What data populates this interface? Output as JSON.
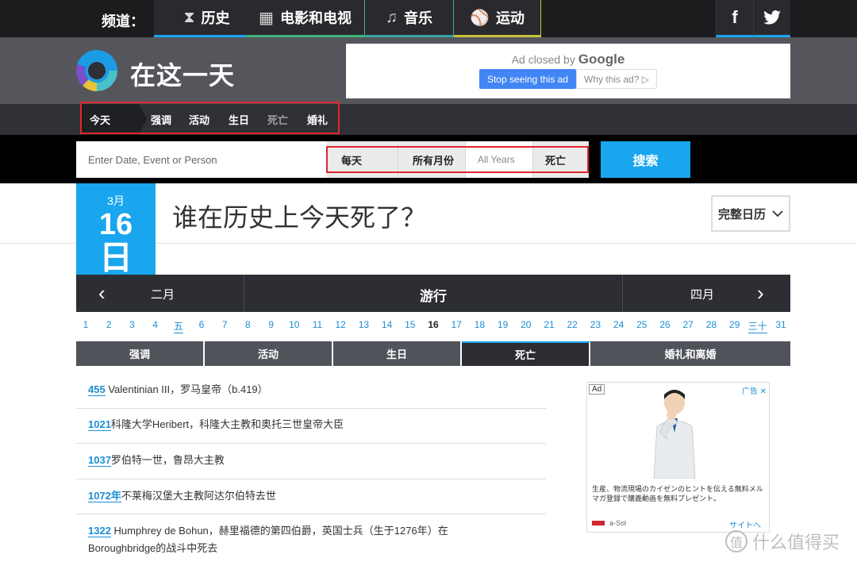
{
  "topbar": {
    "channel_label": "频道：",
    "channels": [
      {
        "label": "历史",
        "icon": "hourglass-icon"
      },
      {
        "label": "电影和电视",
        "icon": "film-icon"
      },
      {
        "label": "音乐",
        "icon": "music-note-icon"
      },
      {
        "label": "运动",
        "icon": "ball-icon"
      }
    ],
    "social": {
      "facebook": "f",
      "twitter": "t"
    }
  },
  "header": {
    "site_title": "在这一天",
    "ad": {
      "closed_by": "Ad closed by",
      "google": "Google",
      "stop_label": "Stop seeing this ad",
      "why_label": "Why this ad? ▷"
    }
  },
  "subnav": {
    "items": [
      "今天",
      "强调",
      "活动",
      "生日",
      "死亡",
      "婚礼"
    ]
  },
  "search": {
    "placeholder": "Enter Date, Event or Person",
    "filters": [
      "每天",
      "所有月份",
      "All Years",
      "死亡"
    ],
    "button_label": "搜索"
  },
  "date": {
    "month": "3月",
    "day": "16",
    "unit": "日"
  },
  "page_title": "谁在历史上今天死了？",
  "calendar_button": "完整日历",
  "month_nav": {
    "prev": "二月",
    "current": "游行",
    "next": "四月"
  },
  "days": [
    "1",
    "2",
    "3",
    "4",
    "五",
    "6",
    "7",
    "8",
    "9",
    "10",
    "11",
    "12",
    "13",
    "14",
    "15",
    "16",
    "17",
    "18",
    "19",
    "20",
    "21",
    "22",
    "23",
    "24",
    "25",
    "26",
    "27",
    "28",
    "29",
    "三十",
    "31"
  ],
  "current_day": "16",
  "categories": [
    "强调",
    "活动",
    "生日",
    "死亡",
    "婚礼和离婚"
  ],
  "active_category": "死亡",
  "entries": [
    {
      "year": "455",
      "text": " Valentinian III，罗马皇帝（b.419）"
    },
    {
      "year": "1021",
      "text": "科隆大学Heribert，科隆大主教和奥托三世皇帝大臣"
    },
    {
      "year": "1037",
      "text": "罗伯特一世，鲁昂大主教"
    },
    {
      "year": "1072年",
      "text": "不莱梅汉堡大主教阿达尔伯特去世"
    },
    {
      "year": "1322",
      "text": " Humphrey de Bohun，赫里福德的第四伯爵，英国士兵（生于1276年）在Boroughbridge的战斗中死去"
    }
  ],
  "side_ad": {
    "badge": "Ad",
    "corner": "广告 ✕",
    "text": "生産、物流現場のカイゼンのヒントを伝える無料メルマガ登録で購義動画を無料プレゼント。",
    "brand": "a-Sol",
    "site_link": "サイトへ"
  },
  "watermark": {
    "symbol": "值",
    "text": "什么值得买"
  },
  "colors": {
    "accent": "#19a6ee",
    "dark": "#1c1c1f",
    "highlight_box": "#e0262d"
  }
}
